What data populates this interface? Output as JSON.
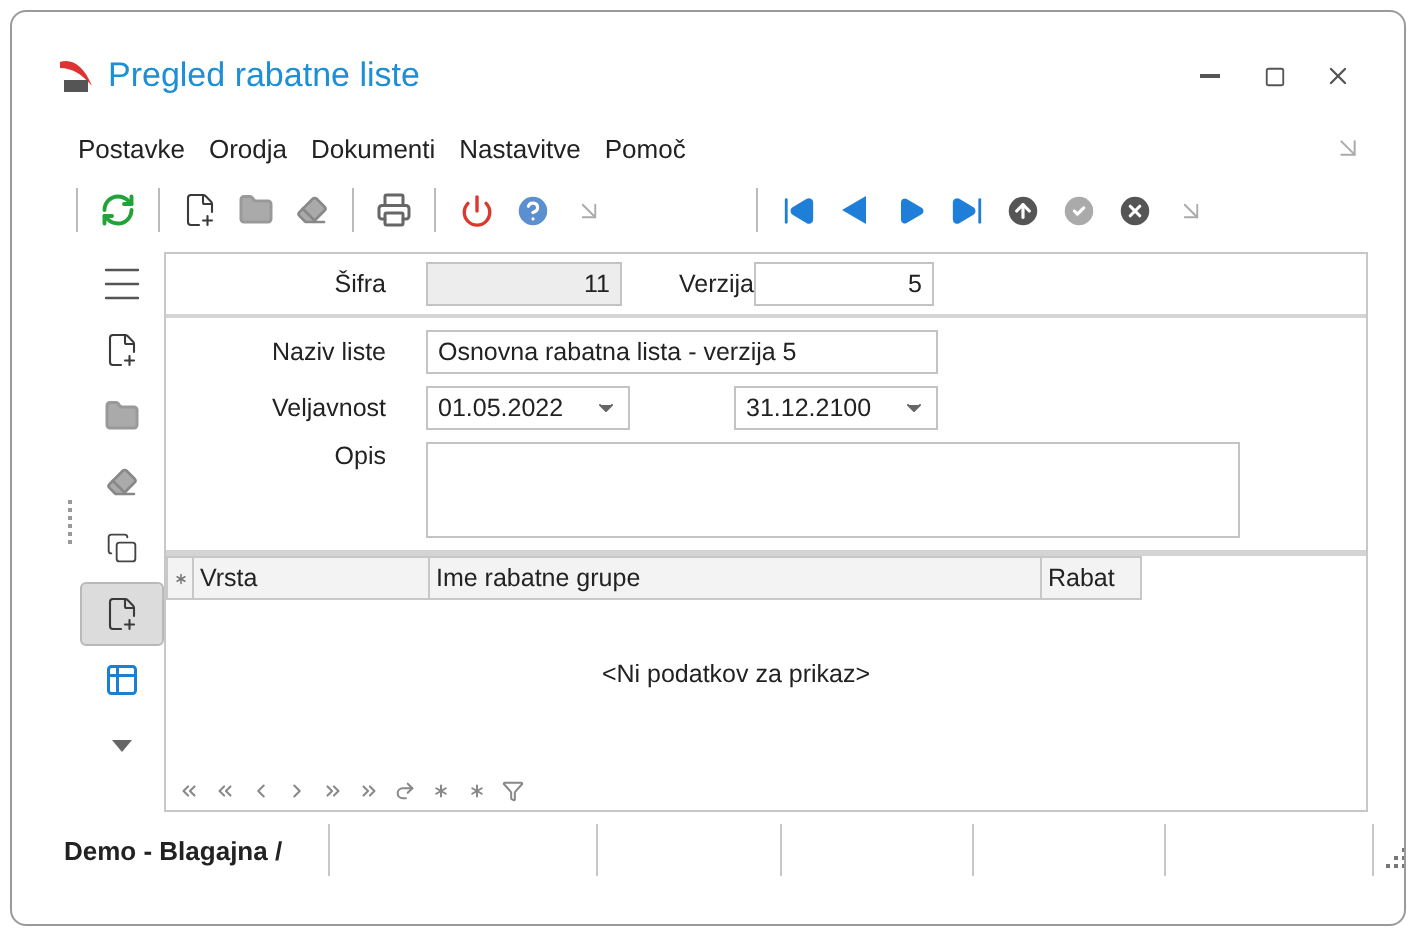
{
  "window": {
    "title": "Pregled rabatne liste"
  },
  "menu": [
    "Postavke",
    "Orodja",
    "Dokumenti",
    "Nastavitve",
    "Pomoč"
  ],
  "sidebar": [
    {
      "kind": "menu",
      "selected": false
    },
    {
      "kind": "new",
      "selected": false
    },
    {
      "kind": "folder",
      "selected": false
    },
    {
      "kind": "eraser",
      "selected": false
    },
    {
      "kind": "copy",
      "selected": false
    },
    {
      "kind": "new",
      "selected": true
    },
    {
      "kind": "table",
      "selected": false
    },
    {
      "kind": "caret",
      "selected": false
    }
  ],
  "header": {
    "code": {
      "label": "Šifra",
      "value": "11",
      "disabled": true
    },
    "version": {
      "label": "Verzija",
      "value": "5",
      "disabled": false
    }
  },
  "form": {
    "name": {
      "label": "Naziv liste",
      "value": "Osnovna rabatna lista - verzija 5"
    },
    "validity": {
      "label": "Veljavnost",
      "from": "01.05.2022",
      "to": "31.12.2100"
    },
    "description": {
      "label": "Opis"
    }
  },
  "table": {
    "columns": [
      "Vrsta",
      "Ime rabatne grupe",
      "Rabat"
    ],
    "empty_text": "<Ni podatkov za prikaz>"
  },
  "status_bar": {
    "text": "Demo - Blagajna /"
  }
}
